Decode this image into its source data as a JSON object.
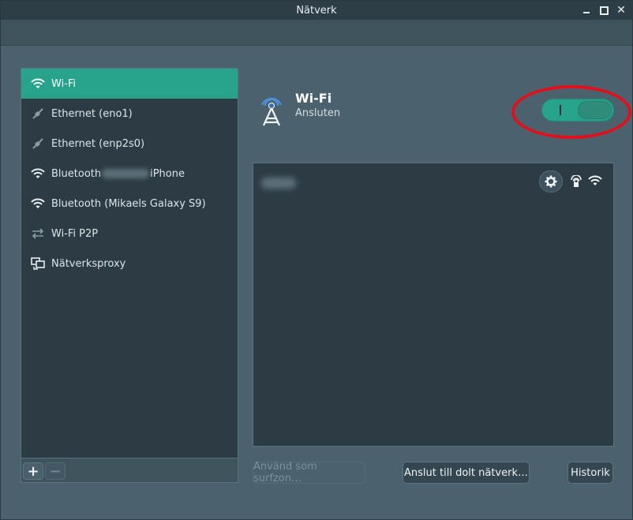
{
  "window": {
    "title": "Nätverk",
    "controls": {
      "minimize": "minimize",
      "maximize": "maximize",
      "close": "✕"
    }
  },
  "sidebar": {
    "items": [
      {
        "label": "Wi-Fi",
        "icon": "wifi-icon",
        "active": true
      },
      {
        "label": "Ethernet (eno1)",
        "icon": "ethernet-icon",
        "active": false
      },
      {
        "label": "Ethernet (enp2s0)",
        "icon": "ethernet-icon",
        "active": false
      },
      {
        "label_prefix": "Bluetooth",
        "label_suffix": "iPhone",
        "icon": "wifi-icon",
        "active": false
      },
      {
        "label": "Bluetooth (Mikaels Galaxy S9)",
        "icon": "wifi-icon",
        "active": false
      },
      {
        "label": "Wi-Fi P2P",
        "icon": "arrows-icon",
        "active": false
      },
      {
        "label": "Nätverksproxy",
        "icon": "network-proxy-icon",
        "active": false
      }
    ],
    "toolbar": {
      "add": "+",
      "remove": "−"
    }
  },
  "main": {
    "title": "Wi-Fi",
    "status": "Ansluten",
    "toggle": {
      "label": "I",
      "state": "on"
    },
    "networks": [
      {
        "name_blurred": true,
        "secured": true,
        "signal": "full"
      }
    ],
    "buttons": {
      "hotspot": "Använd som surfzon…",
      "hidden": "Anslut till dolt nätverk…",
      "history": "Historik"
    }
  },
  "colors": {
    "accent": "#26a38a",
    "annotation": "#e0101c",
    "panel": "#2d3c44",
    "background": "#4b616d"
  }
}
